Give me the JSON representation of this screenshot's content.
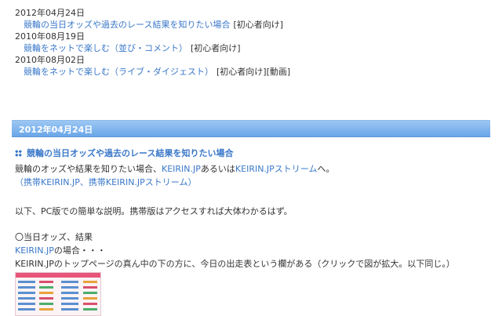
{
  "recent_posts": [
    {
      "date": "2012年04月24日",
      "title": "競輪の当日オッズや過去のレース結果を知りたい場合",
      "tags": "[初心者向け]"
    },
    {
      "date": "2010年08月19日",
      "title": "競輪をネットで楽しむ（並び・コメント）",
      "tags": "[初心者向け]"
    },
    {
      "date": "2010年08月02日",
      "title": "競輪をネットで楽しむ（ライブ・ダイジェスト）",
      "tags": "[初心者向け][動画]"
    }
  ],
  "article": {
    "date": "2012年04月24日",
    "title": "競輪の当日オッズや過去のレース結果を知りたい場合",
    "p1_prefix": "競輪のオッズや結果を知りたい場合、",
    "p1_link1": "KEIRIN.JP",
    "p1_mid": "あるいは",
    "p1_link2": "KEIRIN.JPストリーム",
    "p1_suffix": "へ。",
    "p2": "（携帯KEIRIN.JP、携帯KEIRIN.JPストリーム）",
    "p3": "以下、PC版での簡単な説明。携帯版はアクセスすれば大体わかるはず。",
    "p4": "〇当日オッズ、結果",
    "p5_link": "KEIRIN.JP",
    "p5_suffix": "の場合・・・",
    "p6": "KEIRIN.JPのトップページの真ん中の下の方に、今日の出走表という欄がある（クリックで図が拡大。以下同じ。）"
  },
  "colors": {
    "link": "#3a78c9",
    "date_bar": "#6aa6e8",
    "text": "#333333"
  }
}
